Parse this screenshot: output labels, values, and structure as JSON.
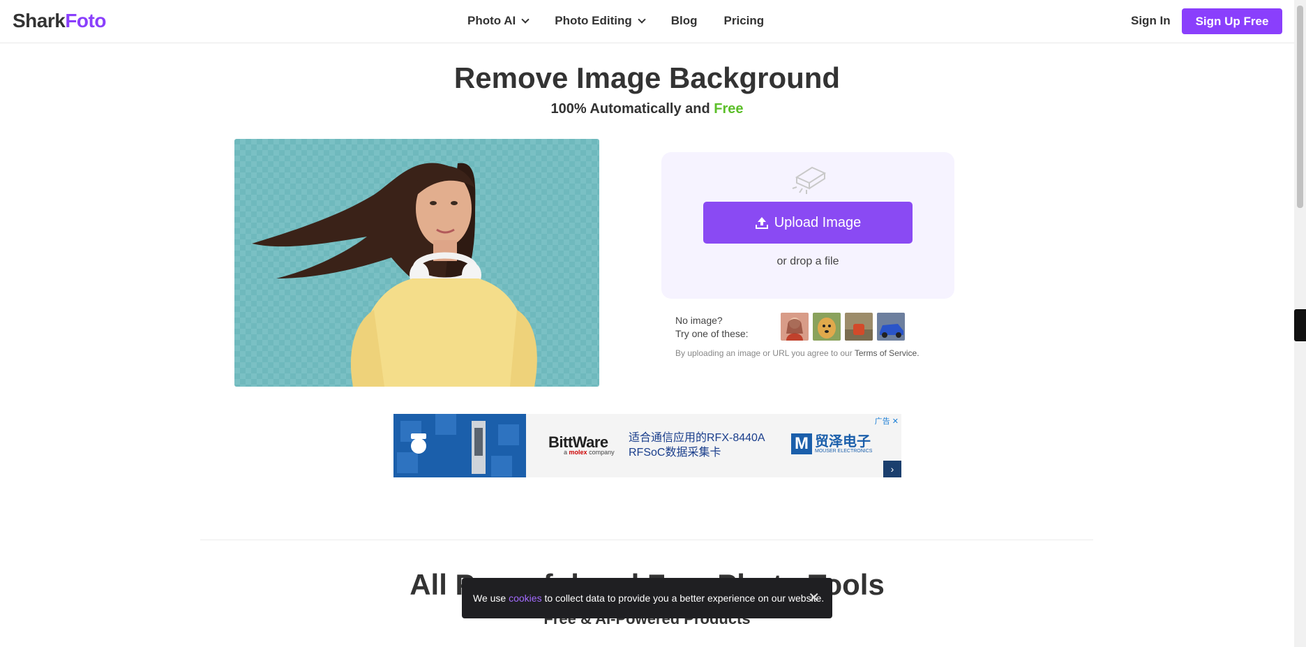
{
  "nav": {
    "logo_part1": "Shark",
    "logo_part2": "Foto",
    "items": [
      {
        "label": "Photo AI",
        "dropdown": true
      },
      {
        "label": "Photo Editing",
        "dropdown": true
      },
      {
        "label": "Blog",
        "dropdown": false
      },
      {
        "label": "Pricing",
        "dropdown": false
      }
    ],
    "sign_in": "Sign In",
    "sign_up": "Sign Up Free"
  },
  "hero": {
    "title": "Remove Image Background",
    "subtitle_main": "100% Automatically and",
    "subtitle_accent": "Free"
  },
  "upload": {
    "button_label": "Upload Image",
    "drop_text": "or drop a file",
    "no_image_line1": "No image?",
    "no_image_line2": "Try one of these:",
    "terms_prefix": "By uploading an image or URL you agree to our",
    "terms_link": "Terms of Service."
  },
  "ad": {
    "brand": "BittWare",
    "brand_sub_prefix": "a",
    "brand_sub_bold": "molex",
    "brand_sub_suffix": "company",
    "copy_line1": "适合通信应用的RFX-8440A",
    "copy_line2": "RFSoC数据采集卡",
    "mouser_logo": "M",
    "mouser_name": "贸泽电子",
    "mouser_sub": "MOUSER ELECTRONICS",
    "tag": "广告",
    "close": "✕",
    "next": "›"
  },
  "tools": {
    "title": "All Powerful and Free Photo Tools",
    "subtitle": "Free & AI-Powered Products"
  },
  "cookie": {
    "prefix": "We use",
    "link": "cookies",
    "suffix": "to collect data to provide you a better experience on our website.",
    "close": "✕"
  },
  "colors": {
    "brand_purple": "#8a3ffc",
    "accent_green": "#5cbf2a"
  }
}
